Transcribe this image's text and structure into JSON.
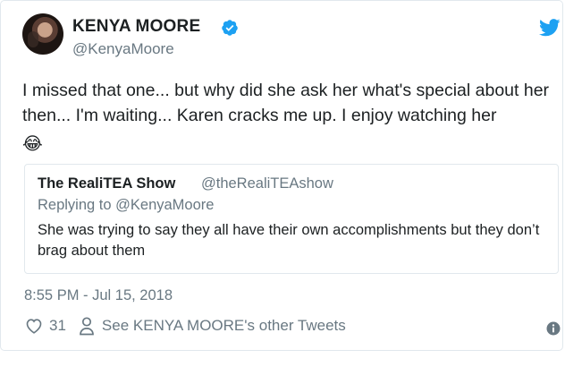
{
  "author": {
    "display_name": "KENYA MOORE",
    "handle": "@KenyaMoore",
    "verified": true,
    "avatar_icon": "avatar-photo"
  },
  "tweet": {
    "text": "I missed that one... but why did she ask her what's special about her then... I'm waiting... Karen cracks me up. I enjoy watching her",
    "emoji": "😂",
    "timestamp": "8:55 PM - Jul 15, 2018"
  },
  "quoted_tweet": {
    "name": "The RealiTEA Show",
    "handle": "@theRealiTEAshow",
    "replying_to": "Replying to @KenyaMoore",
    "text": "She was trying to say they all have their own accomplishments but they don’t brag about them"
  },
  "actions": {
    "like_count": "31",
    "other_tweets_label": "See KENYA MOORE's other Tweets"
  },
  "icons": {
    "brand": "twitter-bird-icon",
    "verified": "verified-badge-icon",
    "like": "heart-icon",
    "profile": "person-icon",
    "info": "info-icon"
  },
  "colors": {
    "twitter_blue": "#1da1f2",
    "secondary_text": "#697882",
    "primary_text": "#1c2022",
    "border": "#e1e8ed"
  }
}
